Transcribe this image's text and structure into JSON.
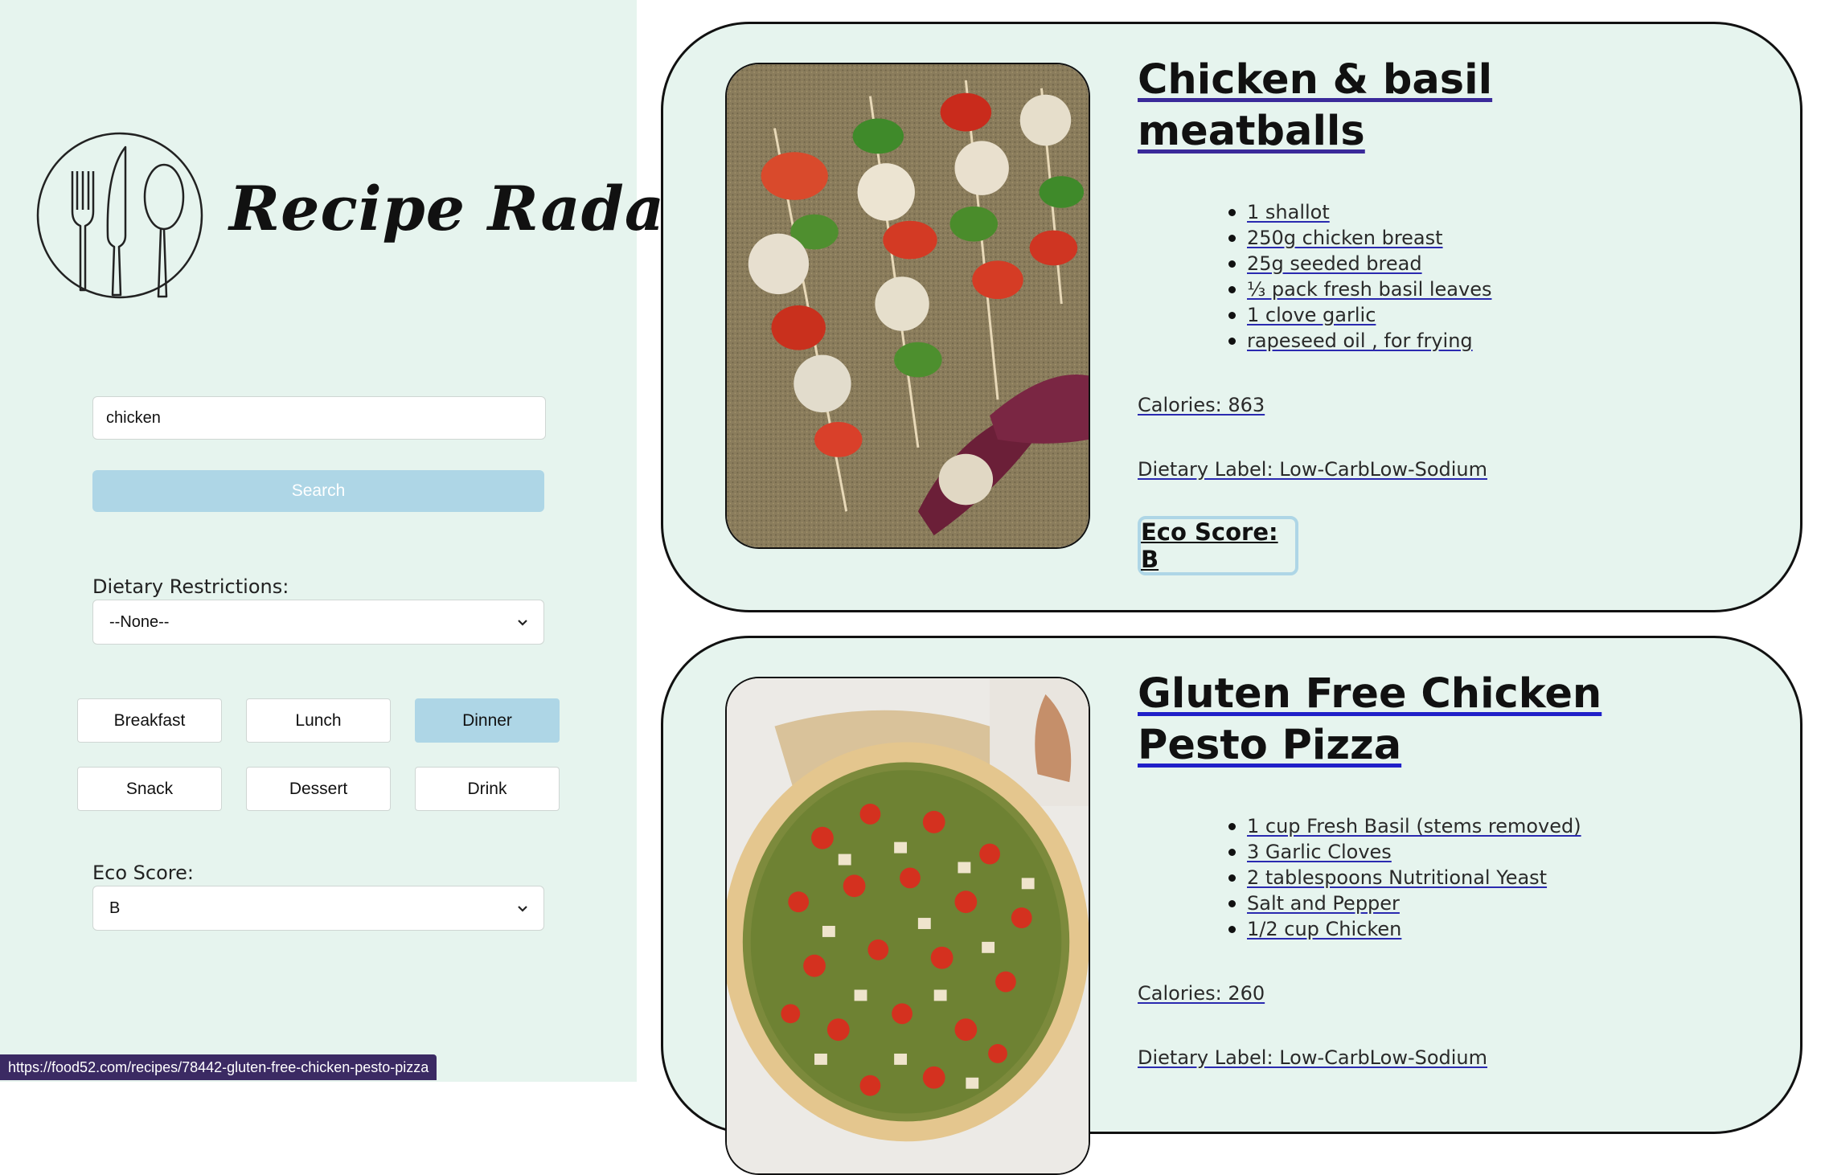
{
  "app": {
    "title": "Recipe Radar"
  },
  "sidebar": {
    "search": {
      "value": "chicken",
      "button_label": "Search"
    },
    "dietary": {
      "label": "Dietary Restrictions:",
      "selected": "--None--"
    },
    "meal_types": [
      {
        "label": "Breakfast",
        "active": false
      },
      {
        "label": "Lunch",
        "active": false
      },
      {
        "label": "Dinner",
        "active": true
      },
      {
        "label": "Snack",
        "active": false
      },
      {
        "label": "Dessert",
        "active": false
      },
      {
        "label": "Drink",
        "active": false
      }
    ],
    "eco": {
      "label": "Eco Score:",
      "selected": "B"
    }
  },
  "results": [
    {
      "title": "Chicken & basil meatballs",
      "ingredients": [
        "1 shallot",
        "250g chicken breast",
        "25g seeded bread",
        "⅓ pack fresh basil leaves",
        "1 clove garlic",
        "rapeseed oil , for frying"
      ],
      "calories": "Calories: 863",
      "dietary_label": "Dietary Label: Low-CarbLow-Sodium",
      "eco_score": "Eco Score: B"
    },
    {
      "title": "Gluten Free Chicken Pesto Pizza",
      "ingredients": [
        "1 cup Fresh Basil (stems removed)",
        "3 Garlic Cloves",
        "2 tablespoons Nutritional Yeast",
        "Salt and Pepper",
        "1/2 cup Chicken"
      ],
      "calories": "Calories: 260",
      "dietary_label": "Dietary Label: Low-CarbLow-Sodium"
    }
  ],
  "status_bar": {
    "url": "https://food52.com/recipes/78442-gluten-free-chicken-pesto-pizza"
  },
  "colors": {
    "panel_bg": "#e6f4ee",
    "accent": "#aed6e6",
    "status_bg": "#3b2a63"
  }
}
